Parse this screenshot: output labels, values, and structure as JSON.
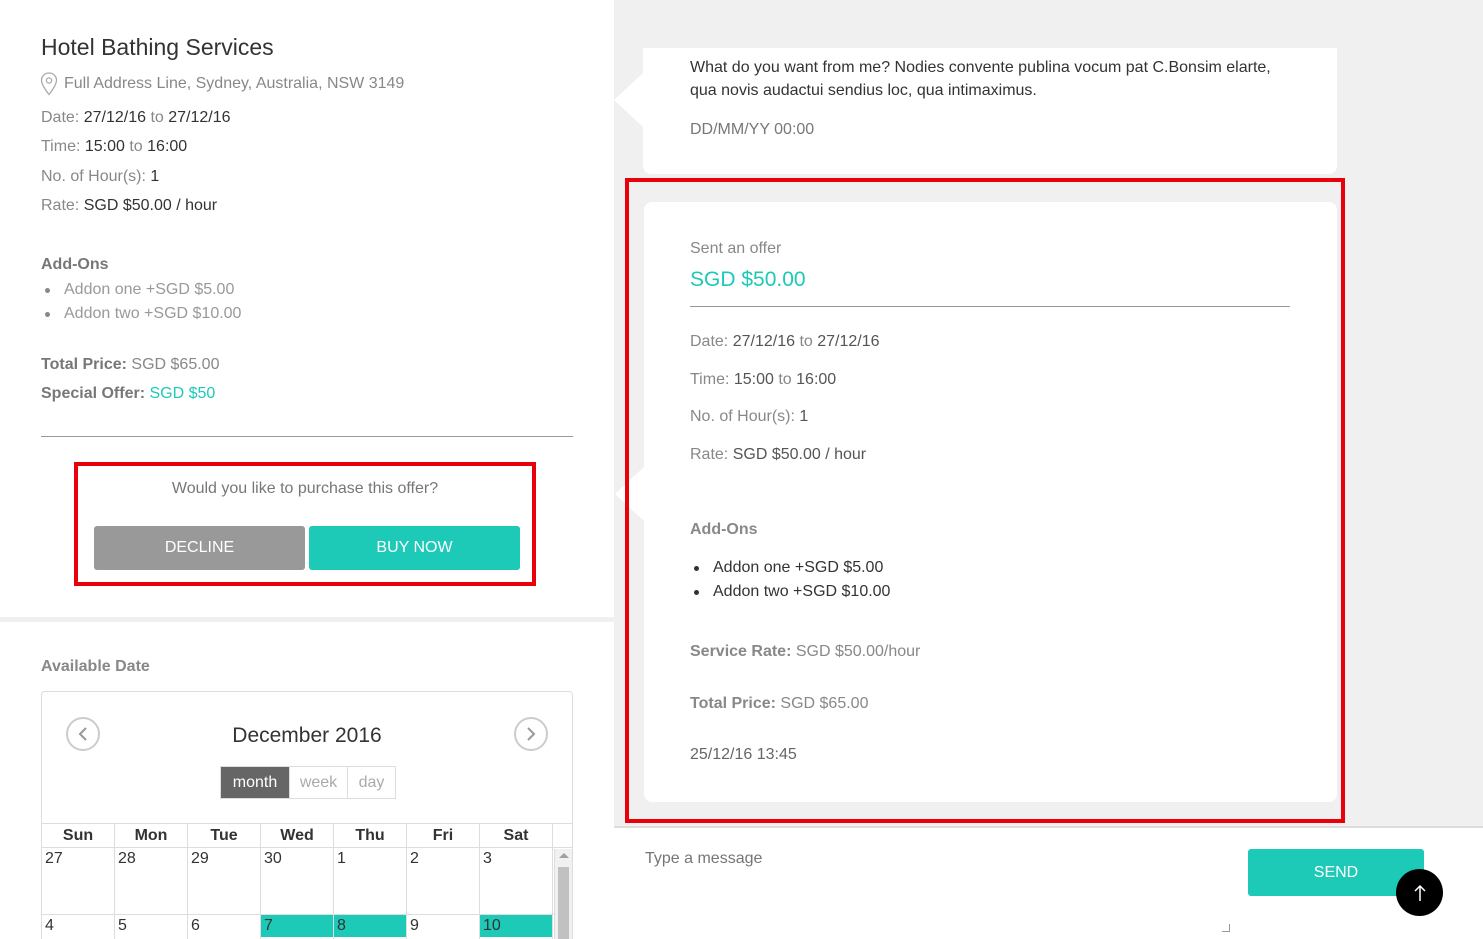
{
  "service": {
    "title": "Hotel Bathing Services",
    "address": "Full Address Line, Sydney, Australia, NSW 3149",
    "date_label": "Date:",
    "date_from": "27/12/16",
    "date_to_word": "to",
    "date_to": "27/12/16",
    "time_label": "Time:",
    "time_from": "15:00",
    "time_to_word": "to",
    "time_to": "16:00",
    "hours_label": "No. of Hour(s):",
    "hours_value": "1",
    "rate_label": "Rate:",
    "rate_value": "SGD $50.00 / hour",
    "addons_heading": "Add-Ons",
    "addons": [
      "Addon one +SGD $5.00",
      "Addon two +SGD $10.00"
    ],
    "total_label": "Total Price:",
    "total_value": "SGD $65.00",
    "special_label": "Special Offer:",
    "special_value": "SGD $50"
  },
  "purchase": {
    "question": "Would you like to purchase this offer?",
    "decline_label": "DECLINE",
    "buy_label": "BUY NOW"
  },
  "calendar": {
    "section_label": "Available Date",
    "month_title": "December 2016",
    "views": [
      "month",
      "week",
      "day"
    ],
    "active_view": "month",
    "weekdays": [
      "Sun",
      "Mon",
      "Tue",
      "Wed",
      "Thu",
      "Fri",
      "Sat"
    ],
    "rows": [
      [
        "27",
        "28",
        "29",
        "30",
        "1",
        "2",
        "3"
      ],
      [
        "4",
        "5",
        "6",
        "7",
        "8",
        "9",
        "10"
      ]
    ]
  },
  "chat": {
    "message_text": "What do you want from me? Nodies convente publina vocum pat C.Bonsim elarte, qua novis audactui sendius loc, qua intimaximus.",
    "message_time": "DD/MM/YY 00:00",
    "offer": {
      "sent_label": "Sent an offer",
      "price": "SGD $50.00",
      "date_label": "Date:",
      "date_from": "27/12/16",
      "date_to_word": "to",
      "date_to": "27/12/16",
      "time_label": "Time:",
      "time_from": "15:00",
      "time_to_word": "to",
      "time_to": "16:00",
      "hours_label": "No. of Hour(s):",
      "hours_value": "1",
      "rate_label": "Rate:",
      "rate_value": "SGD $50.00 / hour",
      "addons_heading": "Add-Ons",
      "addons": [
        "Addon one +SGD $5.00",
        "Addon two +SGD $10.00"
      ],
      "service_rate_label": "Service Rate:",
      "service_rate_value": "SGD $50.00/hour",
      "total_label": "Total Price:",
      "total_value": "SGD $65.00",
      "timestamp": "25/12/16 13:45"
    }
  },
  "composer": {
    "placeholder": "Type a message",
    "send_label": "SEND"
  },
  "colors": {
    "accent": "#1dc9b7",
    "highlight_border": "#e8000a",
    "decline": "#999999"
  }
}
